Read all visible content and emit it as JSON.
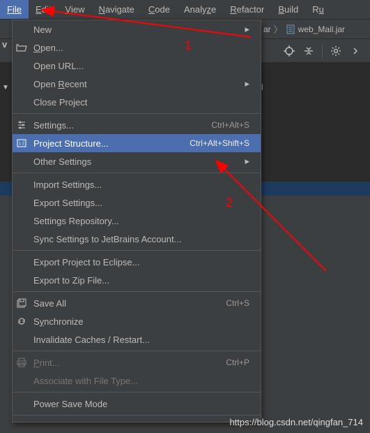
{
  "menubar": {
    "file": "File",
    "edit": "Edit",
    "view": "View",
    "navigate": "Navigate",
    "code": "Code",
    "analyze": "Analyze",
    "refactor": "Refactor",
    "build": "Build",
    "run": "Ru"
  },
  "breadcrumb": {
    "ar_text": "ar",
    "jar_name": "web_Mail.jar"
  },
  "menu": {
    "new": "New",
    "open": "Open...",
    "open_url": "Open URL...",
    "open_recent": "Open Recent",
    "close_project": "Close Project",
    "settings": "Settings...",
    "settings_shortcut": "Ctrl+Alt+S",
    "project_structure": "Project Structure...",
    "project_structure_shortcut": "Ctrl+Alt+Shift+S",
    "other_settings": "Other Settings",
    "import_settings": "Import Settings...",
    "export_settings": "Export Settings...",
    "settings_repository": "Settings Repository...",
    "sync_settings": "Sync Settings to JetBrains Account...",
    "export_eclipse": "Export Project to Eclipse...",
    "export_zip": "Export to Zip File...",
    "save_all": "Save All",
    "save_all_shortcut": "Ctrl+S",
    "synchronize": "Synchronize",
    "invalidate_caches": "Invalidate Caches / Restart...",
    "print": "Print...",
    "print_shortcut": "Ctrl+P",
    "associate_filetype": "Associate with File Type...",
    "power_save": "Power Save Mode"
  },
  "annotations": {
    "label1": "1",
    "label2": "2"
  },
  "watermark": "https://blog.csdn.net/qingfan_714",
  "tab_hint": "l"
}
